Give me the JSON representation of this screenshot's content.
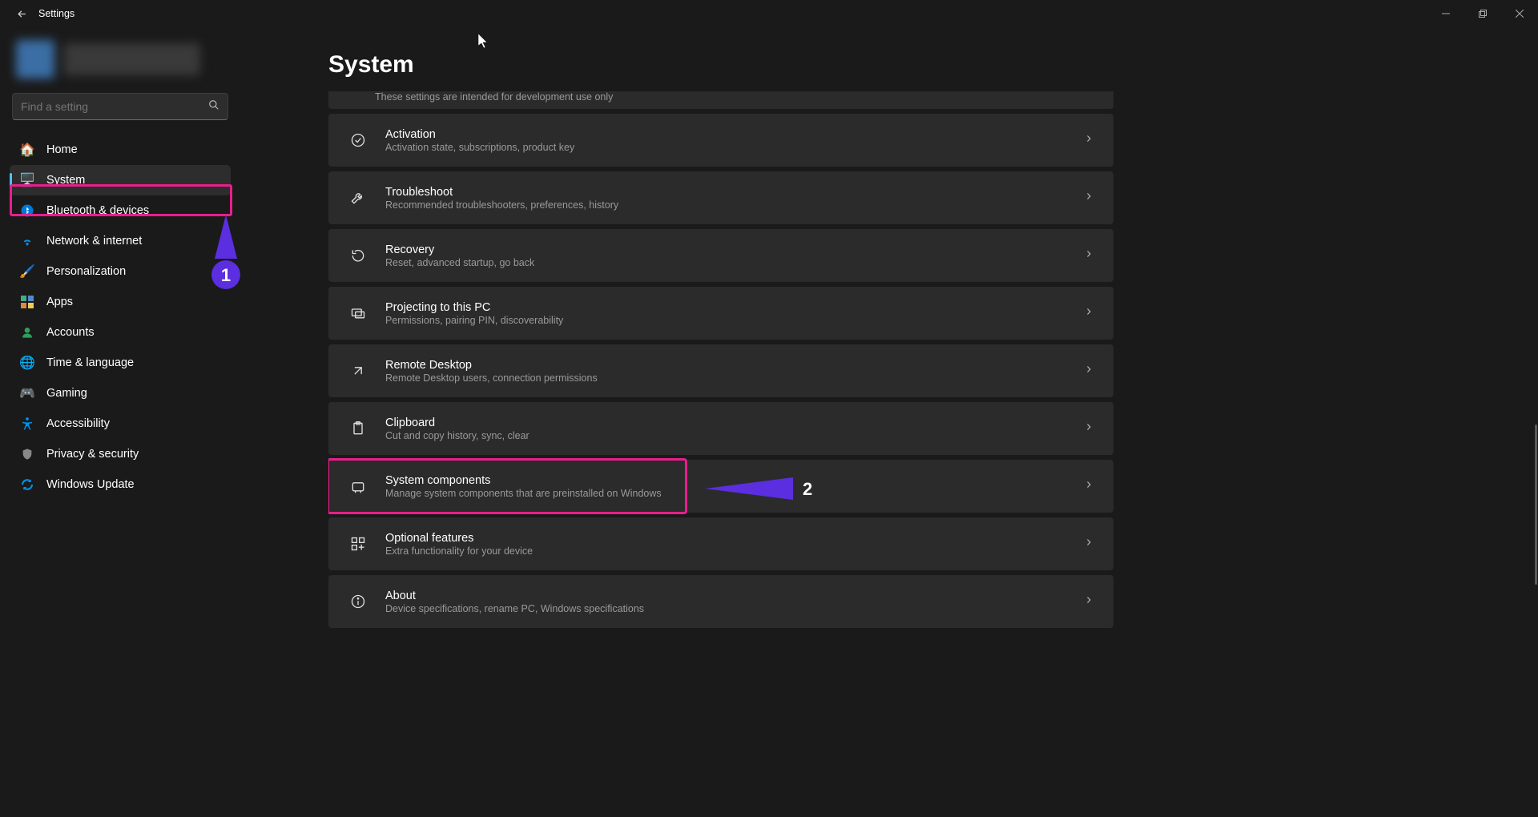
{
  "window": {
    "title": "Settings"
  },
  "search": {
    "placeholder": "Find a setting"
  },
  "nav": {
    "items": [
      {
        "label": "Home"
      },
      {
        "label": "System"
      },
      {
        "label": "Bluetooth & devices"
      },
      {
        "label": "Network & internet"
      },
      {
        "label": "Personalization"
      },
      {
        "label": "Apps"
      },
      {
        "label": "Accounts"
      },
      {
        "label": "Time & language"
      },
      {
        "label": "Gaming"
      },
      {
        "label": "Accessibility"
      },
      {
        "label": "Privacy & security"
      },
      {
        "label": "Windows Update"
      }
    ],
    "selected_index": 1
  },
  "page": {
    "title": "System",
    "cutoff_sub": "These settings are intended for development use only",
    "cards": [
      {
        "title": "Activation",
        "sub": "Activation state, subscriptions, product key"
      },
      {
        "title": "Troubleshoot",
        "sub": "Recommended troubleshooters, preferences, history"
      },
      {
        "title": "Recovery",
        "sub": "Reset, advanced startup, go back"
      },
      {
        "title": "Projecting to this PC",
        "sub": "Permissions, pairing PIN, discoverability"
      },
      {
        "title": "Remote Desktop",
        "sub": "Remote Desktop users, connection permissions"
      },
      {
        "title": "Clipboard",
        "sub": "Cut and copy history, sync, clear"
      },
      {
        "title": "System components",
        "sub": "Manage system components that are preinstalled on Windows"
      },
      {
        "title": "Optional features",
        "sub": "Extra functionality for your device"
      },
      {
        "title": "About",
        "sub": "Device specifications, rename PC, Windows specifications"
      }
    ]
  },
  "annotations": {
    "label1": "1",
    "label2": "2"
  }
}
